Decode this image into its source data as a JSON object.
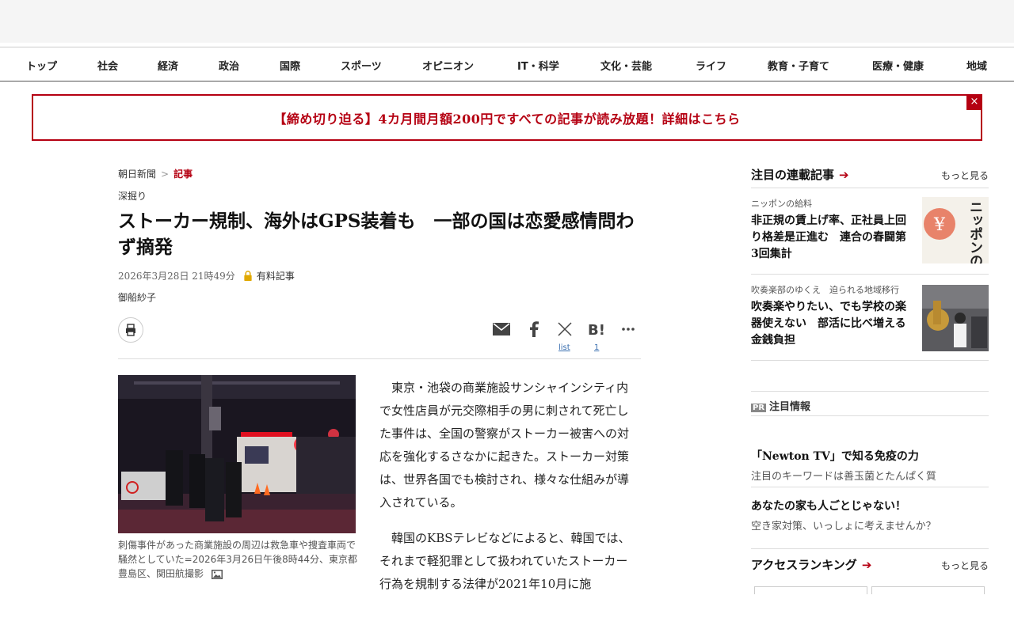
{
  "nav": {
    "items": [
      "トップ",
      "社会",
      "経済",
      "政治",
      "国際",
      "スポーツ",
      "オピニオン",
      "IT・科学",
      "文化・芸能",
      "ライフ",
      "教育・子育て",
      "医療・健康",
      "地域"
    ]
  },
  "promo": {
    "text": "【締め切り迫る】4カ月間月額200円ですべての記事が読み放題！詳細はこちら",
    "close": "×"
  },
  "breadcrumb": {
    "home": "朝日新聞",
    "separator": ">",
    "current": "記事"
  },
  "article": {
    "category": "深掘り",
    "headline": "ストーカー規制、海外はGPS装着も　一部の国は恋愛感情問わず摘発",
    "date": "2026年3月28日 21時49分",
    "paid_label": "有料記事",
    "author": "御船紗子",
    "share": {
      "list_label": "list",
      "hatena_count": "1"
    },
    "photo_caption": "刺傷事件があった商業施設の周辺は救急車や捜査車両で騒然としていた=2026年3月26日午後8時44分、東京都豊島区、関田航撮影",
    "paragraphs": [
      "東京・池袋の商業施設サンシャインシティ内で女性店員が元交際相手の男に刺されて死亡した事件は、全国の警察がストーカー被害への対応を強化するさなかに起きた。ストーカー対策は、世界各国でも検討され、様々な仕組みが導入されている。",
      "韓国のKBSテレビなどによると、韓国では、それまで軽犯罪として扱われていたストーカー行為を規制する法律が2021年10月に施"
    ]
  },
  "sidebar": {
    "series": {
      "title": "注目の連載記事",
      "more": "もっと見る",
      "items": [
        {
          "kicker": "ニッポンの給料",
          "title": "非正規の賃上げ率、正社員上回り格差是正進む　連合の春闘第3回集計",
          "thumb_text": "ニッポンの給料"
        },
        {
          "kicker": "吹奏楽部のゆくえ　迫られる地域移行",
          "title": "吹奏楽やりたい、でも学校の楽器使えない　部活に比べ増える金銭負担"
        }
      ]
    },
    "pr": {
      "badge": "PR",
      "title": "注目情報",
      "items": [
        {
          "title": "「Newton TV」で知る免疫の力",
          "sub": "注目のキーワードは善玉菌とたんぱく質"
        },
        {
          "title": "あなたの家も人ごとじゃない！",
          "sub": "空き家対策、いっしょに考えませんか？"
        }
      ]
    },
    "ranking": {
      "title": "アクセスランキング",
      "more": "もっと見る"
    }
  },
  "colors": {
    "accent": "#b50012",
    "link": "#3a6fb0"
  }
}
